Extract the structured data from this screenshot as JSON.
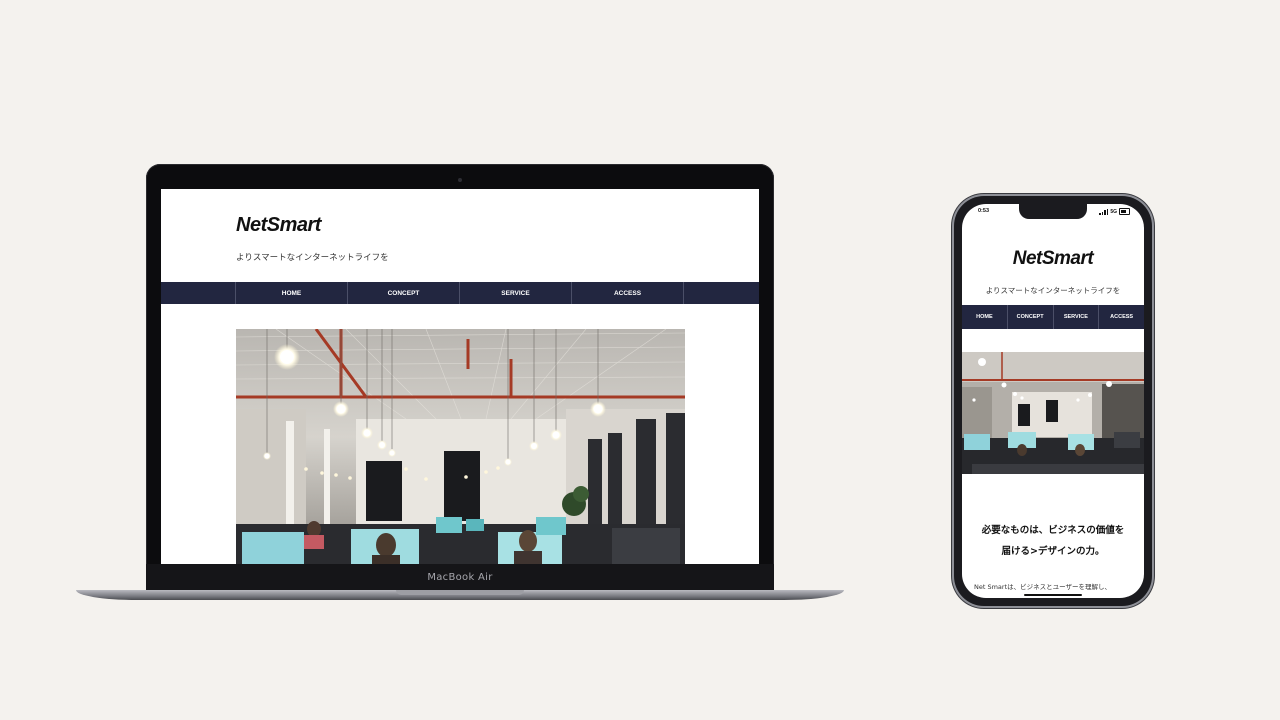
{
  "laptop": {
    "model_label": "MacBook Air",
    "site": {
      "logo": "NetSmart",
      "tagline": "よりスマートなインターネットライフを",
      "nav": [
        "HOME",
        "CONCEPT",
        "SERVICE",
        "ACCESS"
      ]
    }
  },
  "phone": {
    "status": {
      "time": "0:53",
      "network": "5G"
    },
    "site": {
      "logo": "NetSmart",
      "tagline": "よりスマートなインターネットライフを",
      "nav": [
        "HOME",
        "CONCEPT",
        "SERVICE",
        "ACCESS"
      ],
      "heading_line1": "必要なものは、ビジネスの価値を",
      "heading_line2": "届ける>デザインの力。",
      "body_line1": "Net Smartは、ビジネスとユーザーを理解し、"
    }
  },
  "colors": {
    "background": "#f4f2ee",
    "nav_bar": "#222640",
    "pipe_red": "#a53a25",
    "monitor_glow": "#7fd6d8"
  }
}
